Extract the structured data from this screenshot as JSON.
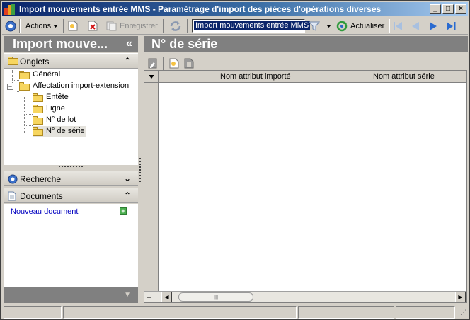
{
  "window": {
    "title": "Import mouvements entrée MMS  -  Paramétrage d'import des pièces d'opérations diverses",
    "minimize": "_",
    "maximize": "□",
    "close": "×"
  },
  "toolbar": {
    "actions_label": "Actions",
    "save_label": "Enregistrer",
    "combo_value": "Import mouvements entrée MMS",
    "refresh_label": "Actualiser"
  },
  "left_panel": {
    "header": "Import mouve...",
    "collapse_glyph": "«",
    "tabs_section": "Onglets",
    "tree": [
      {
        "label": "Général"
      },
      {
        "label": "Affectation import-extension"
      },
      {
        "label": "Entête"
      },
      {
        "label": "Ligne"
      },
      {
        "label": "N° de lot"
      },
      {
        "label": "N° de série"
      }
    ],
    "search_section": "Recherche",
    "documents_section": "Documents",
    "new_document_link": "Nouveau document"
  },
  "right_panel": {
    "header": "N° de série",
    "columns": [
      "Nom attribut importé",
      "Nom attribut série"
    ],
    "rows": []
  },
  "colors": {
    "title_gradient_start": "#0a246a",
    "title_gradient_end": "#a6caf0",
    "panel_header": "#808080",
    "face": "#d4d0c8",
    "link": "#0000c0"
  }
}
